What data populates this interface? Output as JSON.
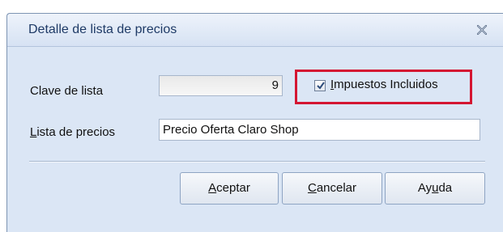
{
  "dialog": {
    "title": "Detalle de lista de precios",
    "close_icon": "close-icon"
  },
  "form": {
    "clave_label": "Clave de lista",
    "clave_value": "9",
    "impuestos": {
      "label_first": "I",
      "label_rest": "mpuestos Incluidos",
      "checked": true
    },
    "lista_label_first": "L",
    "lista_label_rest": "ista de precios",
    "lista_value": "Precio Oferta Claro Shop"
  },
  "buttons": {
    "aceptar_first": "A",
    "aceptar_rest": "ceptar",
    "cancelar_first": "C",
    "cancelar_rest": "ancelar",
    "ayuda_pre": "Ay",
    "ayuda_ul": "u",
    "ayuda_post": "da"
  },
  "colors": {
    "highlight": "#d41632",
    "dialog_bg": "#dbe6f5",
    "title_text": "#1e3a66"
  }
}
